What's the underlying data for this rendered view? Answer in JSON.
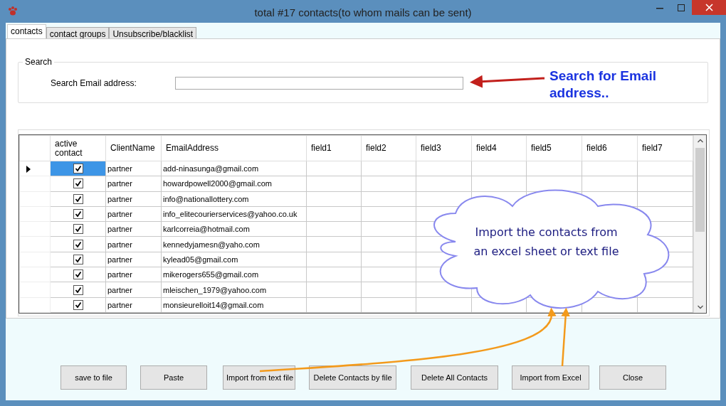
{
  "window": {
    "title": "total #17 contacts(to whom mails can be sent)"
  },
  "tabs": [
    {
      "label": "contacts",
      "selected": true
    },
    {
      "label": "contact groups",
      "selected": false
    },
    {
      "label": "Unsubscribe/blacklist",
      "selected": false
    }
  ],
  "search": {
    "group_title": "Search",
    "label": "Search Email  address:"
  },
  "table": {
    "columns": [
      "active contact",
      "ClientName",
      "EmailAddress",
      "field1",
      "field2",
      "field3",
      "field4",
      "field5",
      "field6",
      "field7"
    ],
    "rows": [
      {
        "checked": true,
        "client": "partner",
        "email": "add-ninasunga@gmail.com",
        "selected": true
      },
      {
        "checked": true,
        "client": "partner",
        "email": "howardpowell2000@gmail.com",
        "selected": false
      },
      {
        "checked": true,
        "client": "partner",
        "email": "info@nationallottery.com",
        "selected": false
      },
      {
        "checked": true,
        "client": "partner",
        "email": "info_elitecourierservices@yahoo.co.uk",
        "selected": false
      },
      {
        "checked": true,
        "client": "partner",
        "email": "karlcorreia@hotmail.com",
        "selected": false
      },
      {
        "checked": true,
        "client": "partner",
        "email": "kennedyjamesn@yaho.com",
        "selected": false
      },
      {
        "checked": true,
        "client": "partner",
        "email": "kylead05@gmail.com",
        "selected": false
      },
      {
        "checked": true,
        "client": "partner",
        "email": "mikerogers655@gmail.com",
        "selected": false
      },
      {
        "checked": true,
        "client": "partner",
        "email": "mleischen_1979@yahoo.com",
        "selected": false
      },
      {
        "checked": true,
        "client": "partner",
        "email": "monsieurelloit14@gmail.com",
        "selected": false
      }
    ]
  },
  "buttons": [
    "save to file",
    "Paste",
    "Import from text file",
    "Delete Contacts by file",
    "Delete All Contacts",
    "Import from Excel",
    "Close"
  ],
  "annotations": {
    "search_note": "Search for Email address..",
    "cloud_note": "Import the contacts from an excel sheet or text file"
  }
}
